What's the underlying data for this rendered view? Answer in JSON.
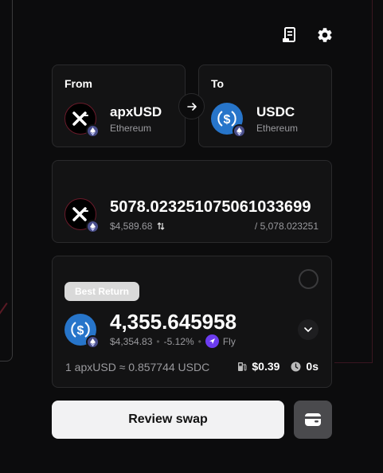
{
  "header": {
    "icons": [
      "receipt-icon",
      "gear-icon"
    ]
  },
  "from": {
    "label": "From",
    "token": "apxUSD",
    "chain": "Ethereum"
  },
  "to": {
    "label": "To",
    "token": "USDC",
    "chain": "Ethereum"
  },
  "input": {
    "amount": "5078.023251075061033699",
    "usd_value": "$4,589.68",
    "balance": "/ 5,078.023251"
  },
  "quote": {
    "badge": "Best Return",
    "amount": "4,355.645958",
    "usd_value": "$4,354.83",
    "price_impact": "-5.12%",
    "provider": "Fly",
    "rate": "1 apxUSD ≈ 0.857744 USDC",
    "gas_fee": "$0.39",
    "eta": "0s"
  },
  "actions": {
    "review_label": "Review swap"
  },
  "colors": {
    "background": "#0c0c0d",
    "card": "#131314",
    "usdc_blue": "#2775ca",
    "apx_red": "#6a1a2a",
    "provider_purple": "#6c3cf0"
  }
}
